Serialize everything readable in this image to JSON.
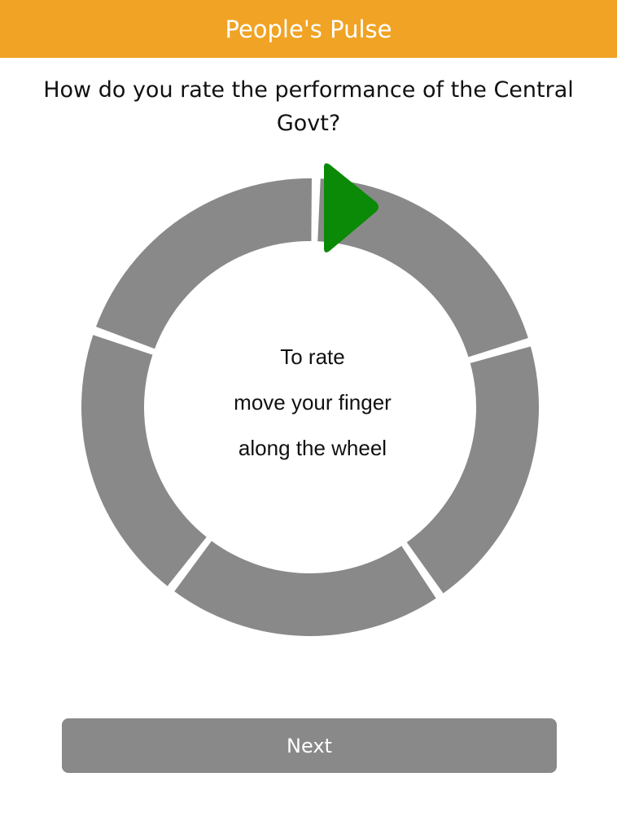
{
  "app": {
    "title": "People's Pulse"
  },
  "question": {
    "text": "How do you rate the performance of the Central Govt?"
  },
  "wheel": {
    "segment_count": 5,
    "selected_rating": null,
    "hint_lines": [
      "To rate",
      "move your finger",
      "along the wheel"
    ]
  },
  "actions": {
    "next_label": "Next"
  },
  "colors": {
    "header": "#F0A324",
    "header_text": "#FFFFFF",
    "segment": "#898989",
    "pointer": "#0A8A06",
    "button": "#898989",
    "button_text": "#FFFFFF"
  },
  "icons": {
    "pointer": "play-triangle-icon"
  }
}
